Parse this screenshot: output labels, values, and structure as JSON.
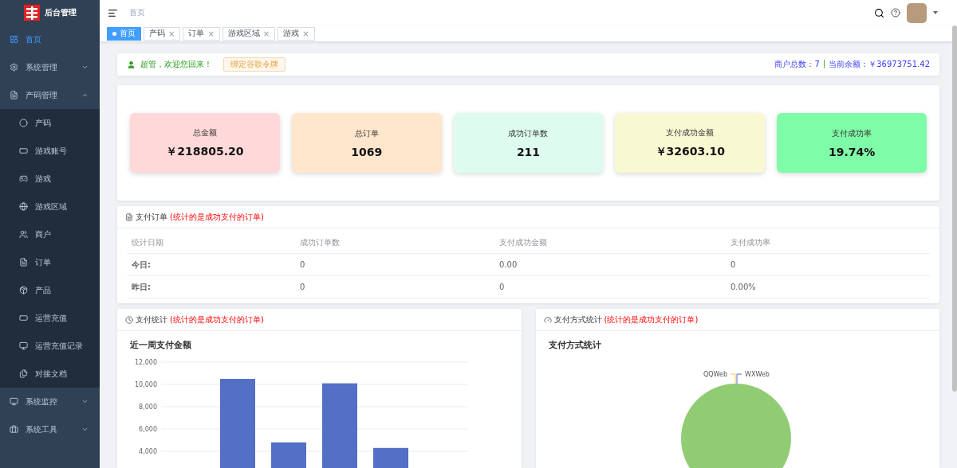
{
  "sidebar": {
    "logo_text": "后台管理",
    "items": [
      {
        "label": "首页",
        "selected": true
      },
      {
        "label": "系统管理",
        "selected": false,
        "expanded": false
      },
      {
        "label": "产码管理",
        "selected": false,
        "expanded": true,
        "children": [
          {
            "label": "产码",
            "selected": false
          },
          {
            "label": "游戏账号",
            "selected": false
          },
          {
            "label": "游戏",
            "selected": false
          },
          {
            "label": "游戏区域",
            "selected": false
          },
          {
            "label": "商户",
            "selected": false
          },
          {
            "label": "订单",
            "selected": false
          },
          {
            "label": "产品",
            "selected": false
          },
          {
            "label": "运营充值",
            "selected": false
          },
          {
            "label": "运营充值记录",
            "selected": false
          },
          {
            "label": "对接文档",
            "selected": false
          }
        ]
      },
      {
        "label": "系统监控",
        "selected": false,
        "expanded": false
      },
      {
        "label": "系统工具",
        "selected": false,
        "expanded": false
      }
    ]
  },
  "header": {
    "breadcrumb": "首页"
  },
  "tags": [
    {
      "label": "首页",
      "selected": true
    },
    {
      "label": "产码",
      "selected": false,
      "close": "×"
    },
    {
      "label": "订单",
      "selected": false,
      "close": "×"
    },
    {
      "label": "游戏区域",
      "selected": false,
      "close": "×"
    },
    {
      "label": "游戏",
      "selected": false,
      "close": "×"
    }
  ],
  "welcome": {
    "greeting": "超管，欢迎您回来！",
    "button": "绑定谷歌令牌",
    "merchant_count": "商户总数：7",
    "separator": "|",
    "balance": "当前余额：￥36973751.42"
  },
  "stats": [
    {
      "label": "总金额",
      "value": "￥218805.20",
      "color": "#ffd9d9"
    },
    {
      "label": "总订单",
      "value": "1069",
      "color": "#ffe6cc"
    },
    {
      "label": "成功订单数",
      "value": "211",
      "color": "#ddfcef"
    },
    {
      "label": "支付成功金额",
      "value": "￥32603.10",
      "color": "#f8f8d3"
    },
    {
      "label": "支付成功率",
      "value": "19.74%",
      "color": "#7ffca8"
    }
  ],
  "orders": {
    "title": "支付订单",
    "note": "(统计的是成功支付的订单)",
    "columns": [
      "统计日期",
      "成功订单数",
      "支付成功金额",
      "支付成功率"
    ],
    "rows": [
      [
        "今日:",
        "0",
        "0.00",
        "0"
      ],
      [
        "昨日:",
        "0",
        "0",
        "0.00%"
      ]
    ]
  },
  "pay_stats": {
    "title": "支付统计",
    "note": "(统计的是成功支付的订单)",
    "chart_data": {
      "type": "bar",
      "title": "近一周支付金额",
      "values": [
        0,
        10500,
        4800,
        10100,
        4300,
        0
      ],
      "ylim": [
        0,
        12000
      ],
      "grid": true,
      "yticks": [
        {
          "value": 4000,
          "label": "4,000"
        },
        {
          "value": 6000,
          "label": "6,000"
        },
        {
          "value": 8000,
          "label": "8,000"
        },
        {
          "value": 10000,
          "label": "10,000"
        },
        {
          "value": 12000,
          "label": "12,000"
        }
      ]
    }
  },
  "pay_methods": {
    "title": "支付方式统计",
    "note": "(统计的是成功支付的订单)",
    "chart_title": "支付方式统计",
    "pie_labels": [
      "QQWeb",
      "WXWeb"
    ]
  }
}
